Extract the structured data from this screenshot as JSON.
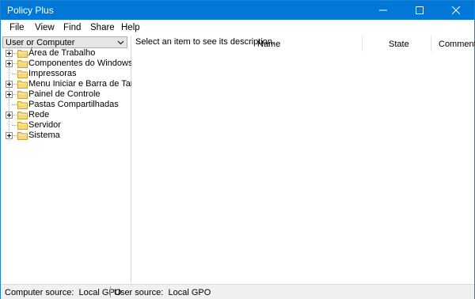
{
  "window": {
    "title": "Policy Plus"
  },
  "menu": [
    "File",
    "View",
    "Find",
    "Share",
    "Help"
  ],
  "left": {
    "combo_value": "User or Computer",
    "tree": [
      {
        "label": "Área de Trabalho",
        "expandable": true
      },
      {
        "label": "Componentes do Windows",
        "expandable": true
      },
      {
        "label": "Impressoras",
        "expandable": false
      },
      {
        "label": "Menu Iniciar e Barra de Tarefas",
        "expandable": true
      },
      {
        "label": "Painel de Controle",
        "expandable": true
      },
      {
        "label": "Pastas Compartilhadas",
        "expandable": false
      },
      {
        "label": "Rede",
        "expandable": true
      },
      {
        "label": "Servidor",
        "expandable": false
      },
      {
        "label": "Sistema",
        "expandable": true
      }
    ]
  },
  "right": {
    "description": "Select an item to see its description.",
    "columns": [
      "Name",
      "State",
      "Comment"
    ]
  },
  "status": {
    "computer": "Computer source:  Local GPO",
    "user": "User source:  Local GPO"
  },
  "colors": {
    "titlebar": "#0078d7",
    "folder": "#f8d775"
  }
}
